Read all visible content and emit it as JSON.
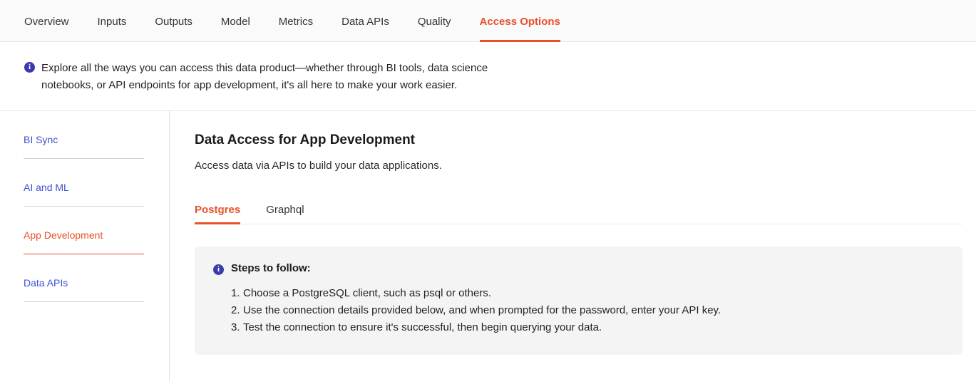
{
  "top_nav": {
    "tabs": [
      {
        "label": "Overview",
        "active": false
      },
      {
        "label": "Inputs",
        "active": false
      },
      {
        "label": "Outputs",
        "active": false
      },
      {
        "label": "Model",
        "active": false
      },
      {
        "label": "Metrics",
        "active": false
      },
      {
        "label": "Data APIs",
        "active": false
      },
      {
        "label": "Quality",
        "active": false
      },
      {
        "label": "Access Options",
        "active": true
      }
    ]
  },
  "banner": {
    "icon": "info-icon",
    "text": "Explore all the ways you can access this data product—whether through BI tools, data science notebooks, or API endpoints for app development, it's all here to make your work easier."
  },
  "sidebar": {
    "items": [
      {
        "label": "BI Sync",
        "active": false
      },
      {
        "label": "AI and ML",
        "active": false
      },
      {
        "label": "App Development",
        "active": true
      },
      {
        "label": "Data APIs",
        "active": false
      }
    ]
  },
  "main": {
    "title": "Data Access for App Development",
    "subtitle": "Access data via APIs to build your data applications.",
    "tabs": [
      {
        "label": "Postgres",
        "active": true
      },
      {
        "label": "Graphql",
        "active": false
      }
    ],
    "steps_panel": {
      "icon": "info-icon",
      "title": "Steps to follow:",
      "steps": [
        {
          "num": "1.",
          "text": "Choose a PostgreSQL client, such as psql or others."
        },
        {
          "num": "2.",
          "text": "Use the connection details provided below, and when prompted for the password, enter your API key."
        },
        {
          "num": "3.",
          "text": "Test the connection to ensure it's successful, then begin querying your data."
        }
      ]
    }
  },
  "colors": {
    "accent_orange": "#e8502a",
    "link_blue": "#3f52d0",
    "info_indigo": "#3b3bae",
    "panel_gray": "#f4f4f4",
    "nav_bg": "#fafafa"
  }
}
